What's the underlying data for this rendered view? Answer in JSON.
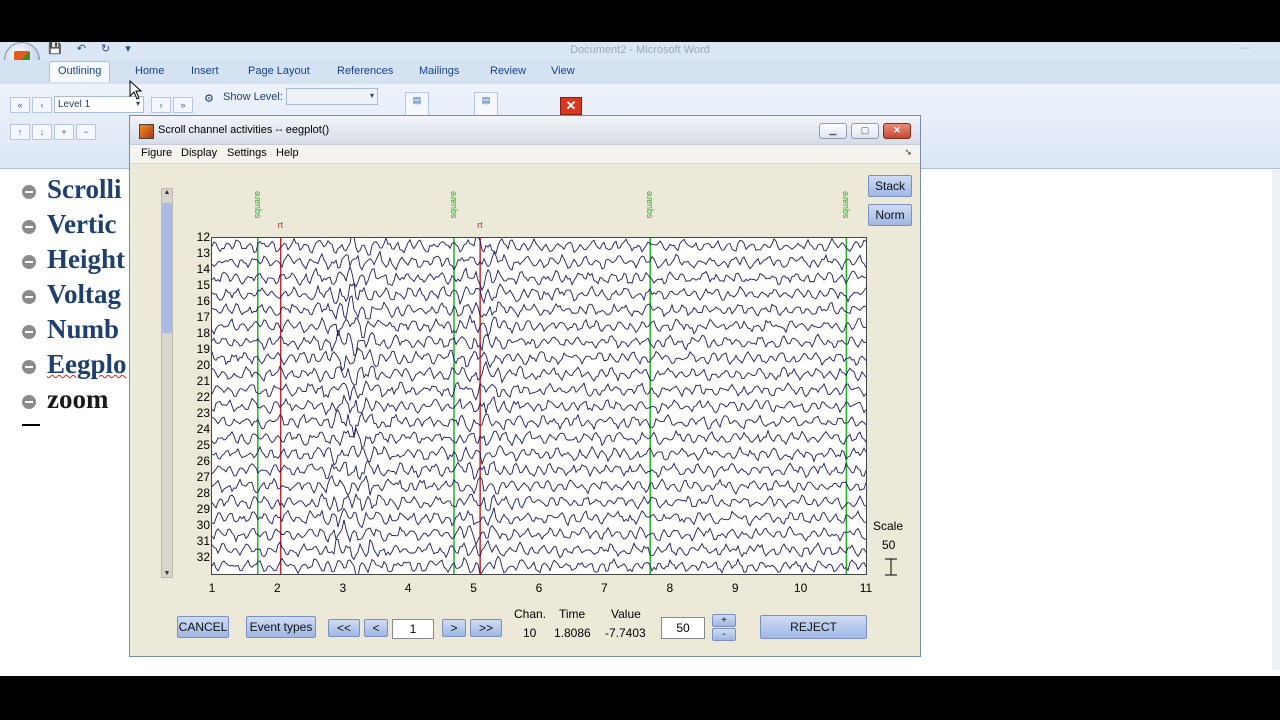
{
  "word": {
    "title": "Document2 - Microsoft Word",
    "tabs": [
      "Outlining",
      "Home",
      "Insert",
      "Page Layout",
      "References",
      "Mailings",
      "Review",
      "View"
    ],
    "active_tab": "Outlining",
    "level_combo": "Level 1",
    "show_level_label": "Show Level:",
    "show_level_value": "",
    "outline_items": [
      "Scrolli",
      "Vertic",
      "Height",
      "Voltag",
      "Numb",
      "Eegplo",
      "zoom"
    ]
  },
  "figure": {
    "title": "Scroll channel activities -- eegplot()",
    "menu": [
      "Figure",
      "Display",
      "Settings",
      "Help"
    ],
    "buttons": {
      "stack": "Stack",
      "norm": "Norm",
      "cancel": "CANCEL",
      "event_types": "Event types",
      "first": "<<",
      "prev": "<",
      "next": ">",
      "last": ">>",
      "reject": "REJECT",
      "plus": "+",
      "minus": "-"
    },
    "window_input": "1",
    "info": {
      "chan_label": "Chan.",
      "time_label": "Time",
      "value_label": "Value",
      "chan": "10",
      "time": "1.8086",
      "value": "-7.7403"
    },
    "scale_input": "50",
    "scale_label": "Scale",
    "scale_value": "50",
    "colors": {
      "trace": "#1a1a5e",
      "event_green": "#1db41d",
      "event_red": "#c0282a",
      "reject_blue": "#9fb7e4"
    }
  },
  "chart_data": {
    "type": "line",
    "title": "",
    "xlabel": "",
    "ylabel": "",
    "channels": [
      "12",
      "13",
      "14",
      "15",
      "16",
      "17",
      "18",
      "19",
      "20",
      "21",
      "22",
      "23",
      "24",
      "25",
      "26",
      "27",
      "28",
      "29",
      "30",
      "31",
      "32"
    ],
    "x_ticks": [
      1,
      2,
      3,
      4,
      5,
      6,
      7,
      8,
      9,
      10,
      11
    ],
    "xlim": [
      1,
      11
    ],
    "events": [
      {
        "type": "square",
        "x": 1.7
      },
      {
        "type": "square",
        "x": 4.7
      },
      {
        "type": "square",
        "x": 7.7
      },
      {
        "type": "square",
        "x": 10.7
      }
    ],
    "red_markers": [
      {
        "label": "rt",
        "x": 2.05
      },
      {
        "label": "rt",
        "x": 5.1
      }
    ],
    "grid": false
  }
}
